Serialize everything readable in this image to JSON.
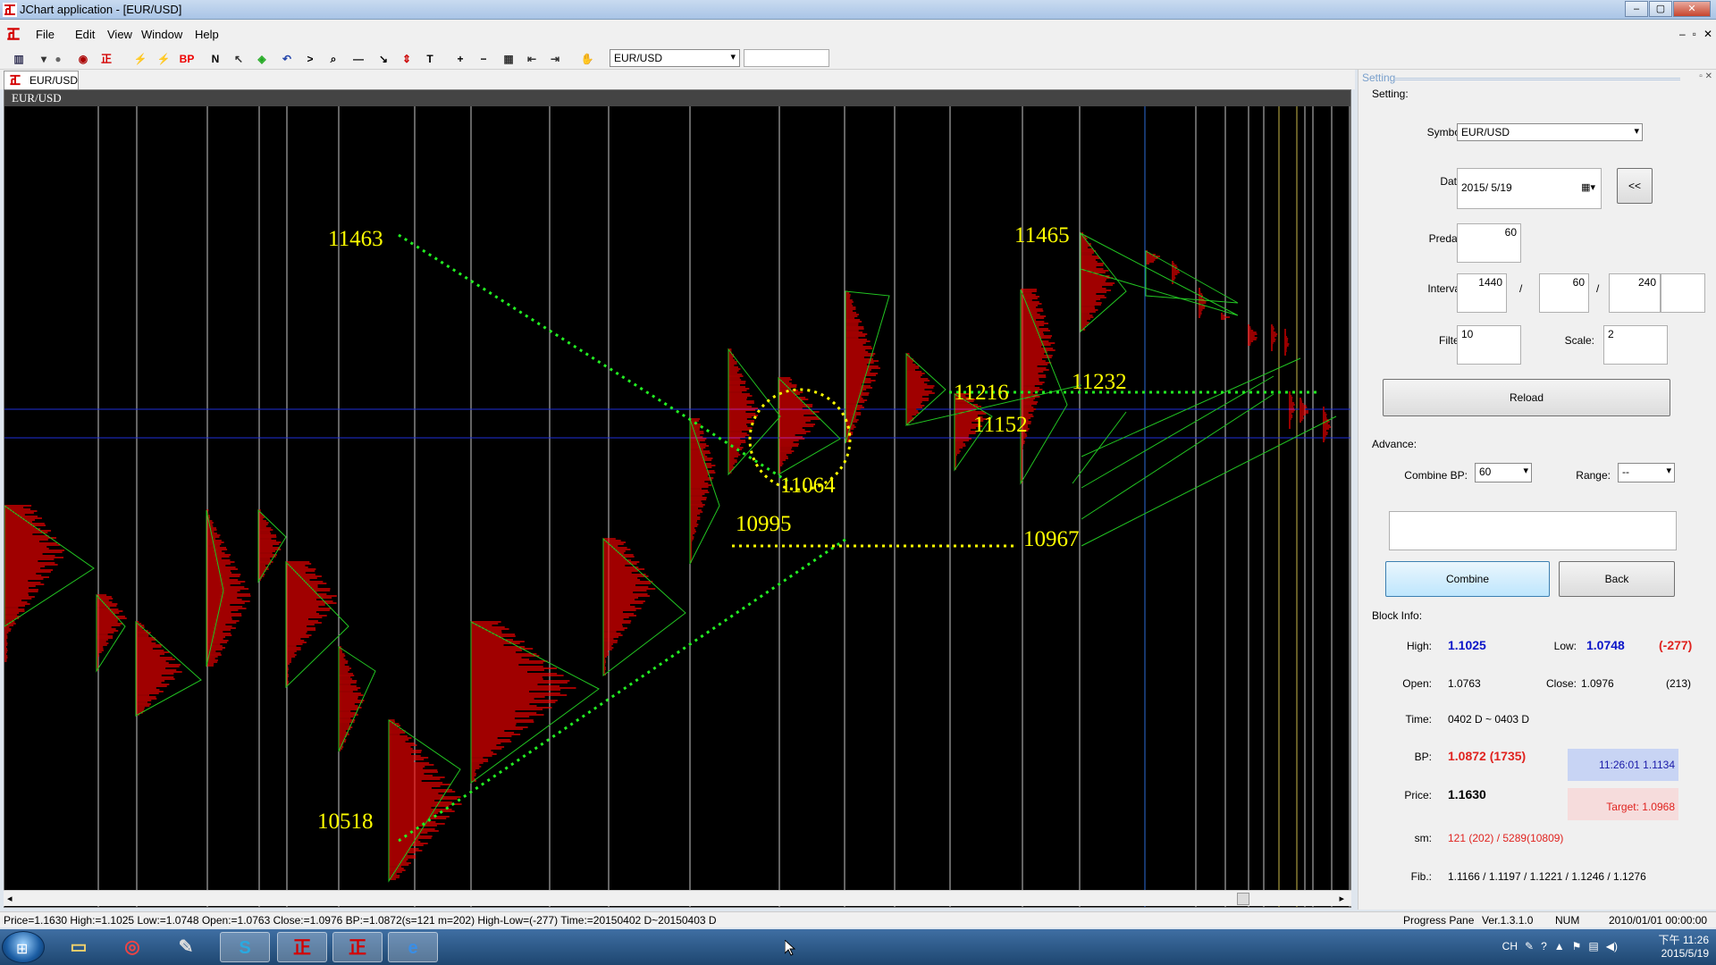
{
  "window": {
    "title": "JChart application - [EUR/USD]",
    "buttons": [
      "–",
      "▢",
      "✕"
    ]
  },
  "menu": {
    "items": [
      "File",
      "Edit",
      "View",
      "Window",
      "Help"
    ],
    "mdi_buttons": [
      "–",
      "▫",
      "✕"
    ]
  },
  "toolbar": {
    "tools": [
      {
        "icon": "bar-chart-icon",
        "glyph": "▥"
      },
      {
        "icon": "dropdown-arrow-icon",
        "glyph": "▾"
      },
      {
        "icon": "globe-icon",
        "glyph": "●"
      },
      {
        "icon": "disk-icon",
        "glyph": "◉"
      },
      {
        "icon": "jchart-logo-icon",
        "glyph": "正"
      },
      {
        "icon": "lightning-icon",
        "glyph": "⚡"
      },
      {
        "icon": "lightning-red-icon",
        "glyph": "⚡"
      },
      {
        "icon": "bp-icon",
        "glyph": "BP"
      },
      {
        "icon": "n-icon",
        "glyph": "N"
      },
      {
        "icon": "cursor-box-icon",
        "glyph": "↖"
      },
      {
        "icon": "stack-icon",
        "glyph": "◈"
      },
      {
        "icon": "undo-icon",
        "glyph": "↶"
      },
      {
        "icon": "arrow-right-icon",
        "glyph": ">"
      },
      {
        "icon": "zoom-icon",
        "glyph": "⌕"
      },
      {
        "icon": "hline-icon",
        "glyph": "—"
      },
      {
        "icon": "diagonal-line-icon",
        "glyph": "↘"
      },
      {
        "icon": "up-down-icon",
        "glyph": "⇕"
      },
      {
        "icon": "text-icon",
        "glyph": "T"
      },
      {
        "icon": "plus-icon",
        "glyph": "+"
      },
      {
        "icon": "minus-icon",
        "glyph": "−"
      },
      {
        "icon": "select-box-icon",
        "glyph": "▦"
      },
      {
        "icon": "arrow-left-box-icon",
        "glyph": "⇤"
      },
      {
        "icon": "arrow-right-box-icon",
        "glyph": "⇥"
      },
      {
        "icon": "hand-icon",
        "glyph": "✋"
      }
    ],
    "symbol_select": "EUR/USD",
    "extra_input": ""
  },
  "tab": {
    "label": "EUR/USD"
  },
  "chart": {
    "header": "EUR/USD",
    "labels": [
      {
        "text": "11463"
      },
      {
        "text": "11465"
      },
      {
        "text": "11216"
      },
      {
        "text": "11232"
      },
      {
        "text": "11152"
      },
      {
        "text": "11064"
      },
      {
        "text": "10995"
      },
      {
        "text": "10967"
      },
      {
        "text": "10518"
      }
    ]
  },
  "panel": {
    "header": "Setting",
    "setting_label": "Setting:",
    "symbol_label": "Symbol:",
    "symbol_value": "EUR/USD",
    "date_label": "Date:",
    "date_value": "2015/  5/19",
    "date_btn": "<<",
    "preday_label": "Preday:",
    "preday_value": "60",
    "interval_label": "Interval:",
    "interval_values": [
      "1440",
      "60",
      "240",
      ""
    ],
    "interval_sep": "/",
    "filter_label": "Filter:",
    "filter_value": "10",
    "scale_label": "Scale:",
    "scale_value": "2",
    "reload_btn": "Reload",
    "advance_label": "Advance:",
    "combine_bp_label": "Combine BP:",
    "combine_bp_value": "60",
    "range_label": "Range:",
    "range_value": "--",
    "advance_text": "",
    "combine_btn": "Combine",
    "back_btn": "Back",
    "block_info_label": "Block Info:",
    "high_label": "High:",
    "high_value": "1.1025",
    "low_label": "Low:",
    "low_value": "1.0748",
    "low_diff": "(-277)",
    "open_label": "Open:",
    "open_value": "1.0763",
    "close_label": "Close:",
    "close_value": "1.0976",
    "close_diff": "(213)",
    "time_label": "Time:",
    "time_value": "0402 D ~ 0403 D",
    "bp_label": "BP:",
    "bp_value": "1.0872 (1735)",
    "quote_value": "11:26:01  1.1134",
    "price_label": "Price:",
    "price_value": "1.1630",
    "target_value": "Target: 1.0968",
    "sm_label": "sm:",
    "sm_value": "121 (202) / 5289(10809)",
    "fib_label": "Fib.:",
    "fib_value": "1.1166 / 1.1197 / 1.1221 / 1.1246 / 1.1276"
  },
  "status": {
    "text": "Price=1.1630  High:=1.1025  Low:=1.0748  Open:=1.0763  Close:=1.0976  BP:=1.0872(s=121 m=202)  High-Low=(-277)  Time:=20150402 D~20150403 D",
    "pane": "Progress Pane",
    "version": "Ver.1.3.1.0",
    "num": "NUM",
    "datetime": "2010/01/01 00:00:00"
  },
  "taskbar": {
    "apps": [
      {
        "name": "explorer-icon",
        "glyph": "▭"
      },
      {
        "name": "chrome-icon",
        "glyph": "◎"
      },
      {
        "name": "notepad-icon",
        "glyph": "✎"
      },
      {
        "name": "skype-icon",
        "glyph": "S"
      },
      {
        "name": "jchart-icon",
        "glyph": "正"
      },
      {
        "name": "jchart-icon-2",
        "glyph": "正"
      },
      {
        "name": "ie-icon",
        "glyph": "e"
      }
    ],
    "lang": "CH",
    "time": "下午 11:26",
    "date": "2015/5/19"
  },
  "colors": {
    "accent_yellow": "#ffff00",
    "profile_red": "#ff0000",
    "line_green": "#22dd22",
    "dotted_green": "#22ee22",
    "panel_blue": "#0a14c8",
    "panel_red": "#e0231f"
  }
}
